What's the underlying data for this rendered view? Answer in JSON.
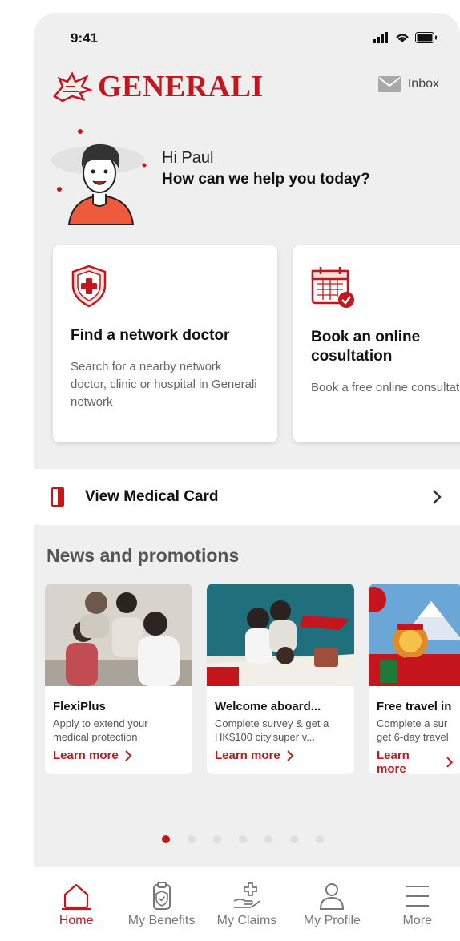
{
  "status": {
    "time": "9:41"
  },
  "header": {
    "brand": "GENERALI",
    "inbox_label": "Inbox"
  },
  "greeting": {
    "hi_prefix": "Hi",
    "name": "Paul",
    "help": "How can we help you today?"
  },
  "cards": [
    {
      "title": "Find a network doctor",
      "desc": "Search for a nearby network doctor, clinic or hospital in Generali network",
      "icon": "shield-cross-icon"
    },
    {
      "title": "Book an online cosultation",
      "desc": "Book a free online consultation",
      "icon": "calendar-check-icon"
    }
  ],
  "medical_card": {
    "label": "View Medical Card"
  },
  "news": {
    "heading": "News and promotions",
    "items": [
      {
        "title": "FlexiPlus",
        "desc": "Apply to extend your medical protection",
        "link": "Learn more"
      },
      {
        "title": "Welcome aboard...",
        "desc": "Complete survey & get a HK$100 city'super v...",
        "link": "Learn more"
      },
      {
        "title": "Free travel in",
        "desc": "Complete a sur get 6-day travel",
        "link": "Learn more"
      }
    ],
    "page_count": 7,
    "active_page": 1
  },
  "tabbar": [
    {
      "label": "Home",
      "icon": "home-icon",
      "active": true
    },
    {
      "label": "My Benefits",
      "icon": "clipboard-shield-icon",
      "active": false
    },
    {
      "label": "My Claims",
      "icon": "hand-cross-icon",
      "active": false
    },
    {
      "label": "My Profile",
      "icon": "person-icon",
      "active": false
    },
    {
      "label": "More",
      "icon": "menu-icon",
      "active": false
    }
  ],
  "colors": {
    "brand": "#c4161c",
    "background": "#efefef"
  }
}
